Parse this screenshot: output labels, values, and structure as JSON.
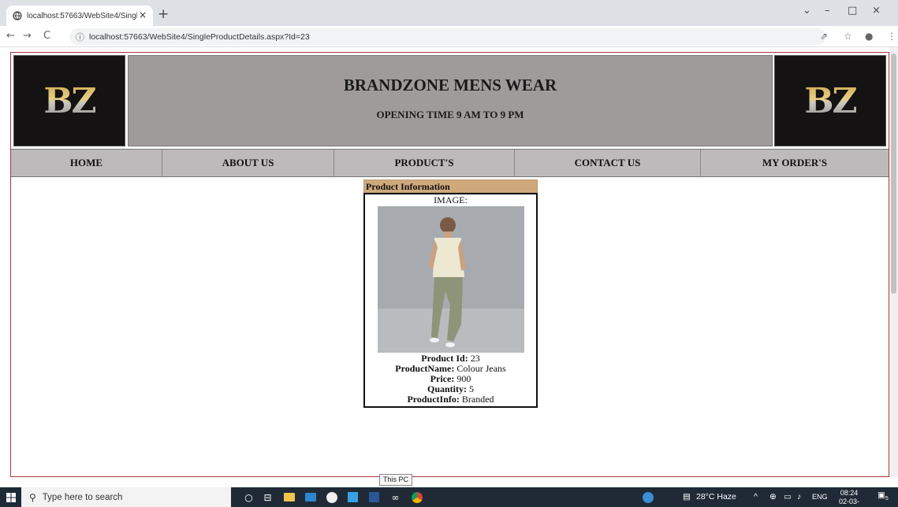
{
  "browser": {
    "tab_title": "localhost:57663/WebSite4/Single",
    "tab_close": "×",
    "new_tab": "+",
    "url": "localhost:57663/WebSite4/SingleProductDetails.aspx?Id=23",
    "window_controls": [
      "⌄",
      "–",
      "□",
      "×"
    ],
    "nav": {
      "back": "←",
      "forward": "→",
      "reload": "C",
      "info": "ⓘ"
    },
    "right_icons": {
      "share": "⇗",
      "bookmark": "☆",
      "profile": "●",
      "menu": "⋮"
    }
  },
  "header": {
    "logo_left": "BZ",
    "logo_right": "BZ",
    "title": "BRANDZONE MENS WEAR",
    "subtitle": "OPENING TIME 9 AM TO 9 PM"
  },
  "menu": {
    "items": [
      "HOME",
      "ABOUT US",
      "PRODUCT'S",
      "CONTACT US",
      "MY ORDER'S"
    ]
  },
  "product": {
    "panel_title": "Product Information",
    "image_label": "IMAGE:",
    "fields": [
      {
        "label": "Product Id:",
        "value": "23"
      },
      {
        "label": "ProductName:",
        "value": "Colour Jeans"
      },
      {
        "label": "Price:",
        "value": "900"
      },
      {
        "label": "Quantity:",
        "value": "5"
      },
      {
        "label": "ProductInfo:",
        "value": "Branded"
      }
    ]
  },
  "taskbar": {
    "tooltip": "This PC",
    "search_placeholder": "Type here to search",
    "weather": "28°C Haze",
    "language": "ENG",
    "time": "08:24",
    "date": "02-03-2022",
    "notifications": "5"
  }
}
